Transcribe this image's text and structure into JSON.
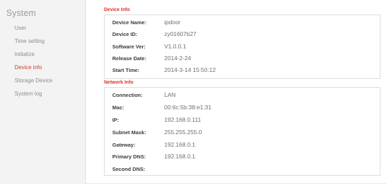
{
  "sidebar": {
    "title": "System",
    "items": [
      {
        "label": "User"
      },
      {
        "label": "Time setting"
      },
      {
        "label": "Initialize"
      },
      {
        "label": "Device info"
      },
      {
        "label": "Storage Device"
      },
      {
        "label": "System log"
      }
    ],
    "active_index": 3
  },
  "device_info": {
    "title": "Device Info",
    "rows": [
      {
        "label": "Device Name:",
        "value": "ipdoor"
      },
      {
        "label": "Device ID:",
        "value": "zy01607b27"
      },
      {
        "label": "Software Ver:",
        "value": "V1.0.0.1"
      },
      {
        "label": "Release Date:",
        "value": "2014-2-24"
      },
      {
        "label": "Start Time:",
        "value": "2014-3-14 15:50:12"
      }
    ]
  },
  "network_info": {
    "title": "Network Info",
    "rows": [
      {
        "label": "Connection:",
        "value": "LAN"
      },
      {
        "label": "Mac:",
        "value": "00:6c:5b:38:e1:31"
      },
      {
        "label": "IP:",
        "value": "192.168.0.111"
      },
      {
        "label": "Subnet Mask:",
        "value": "255.255.255.0"
      },
      {
        "label": "Gateway:",
        "value": "192.168.0.1"
      },
      {
        "label": "Primary DNS:",
        "value": "192.168.0.1"
      },
      {
        "label": "Second DNS:",
        "value": ""
      }
    ]
  },
  "colors": {
    "accent": "#d9362b",
    "sidebar_bg": "#f3f3f3",
    "text_muted": "#8c8c8c"
  }
}
